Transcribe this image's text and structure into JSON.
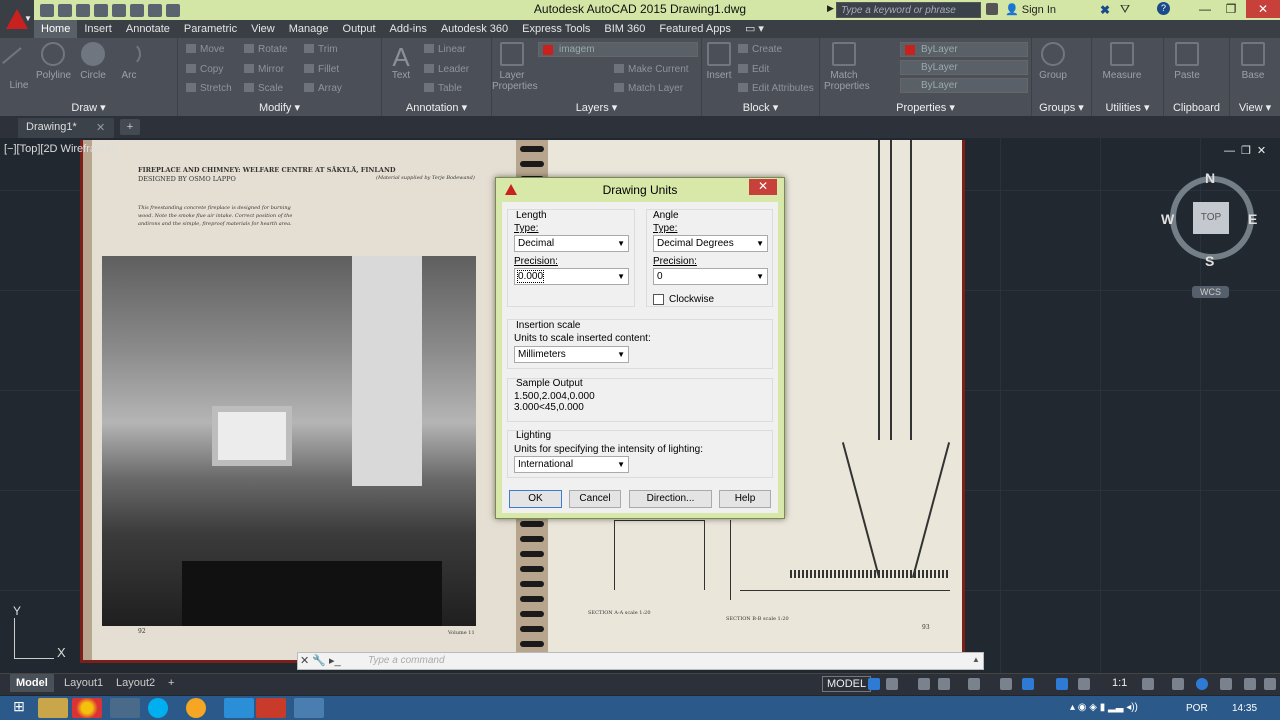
{
  "titlebar": {
    "window_title": "Autodesk AutoCAD 2015    Drawing1.dwg",
    "search_placeholder": "Type a keyword or phrase",
    "signin_label": "Sign In"
  },
  "ribbon_tabs": [
    "Home",
    "Insert",
    "Annotate",
    "Parametric",
    "View",
    "Manage",
    "Output",
    "Add-ins",
    "Autodesk 360",
    "Express Tools",
    "BIM 360",
    "Featured Apps"
  ],
  "ribbon_panels": {
    "draw": {
      "title": "Draw",
      "tools": [
        "Line",
        "Polyline",
        "Circle",
        "Arc"
      ]
    },
    "modify": {
      "title": "Modify",
      "tools": [
        "Move",
        "Rotate",
        "Trim",
        "Copy",
        "Mirror",
        "Fillet",
        "Stretch",
        "Scale",
        "Array"
      ]
    },
    "annotation": {
      "title": "Annotation",
      "tools": [
        "Text",
        "Linear",
        "Leader",
        "Table"
      ]
    },
    "layers": {
      "title": "Layers",
      "current_layer": "imagem",
      "tools": [
        "Layer Properties",
        "Make Current",
        "Match Layer"
      ]
    },
    "block": {
      "title": "Block",
      "tools": [
        "Insert",
        "Create",
        "Edit",
        "Edit Attributes"
      ]
    },
    "properties": {
      "title": "Properties",
      "tools": [
        "Match Properties"
      ],
      "color": "ByLayer",
      "linetype": "ByLayer",
      "lineweight": "ByLayer"
    },
    "groups": {
      "title": "Groups",
      "tools": [
        "Group"
      ]
    },
    "utilities": {
      "title": "Utilities",
      "tools": [
        "Measure"
      ]
    },
    "clipboard": {
      "title": "Clipboard",
      "tools": [
        "Paste"
      ]
    },
    "view": {
      "title": "View",
      "tools": [
        "Base"
      ]
    }
  },
  "file_tab": {
    "label": "Drawing1*"
  },
  "viewport_label": "[−][Top][2D Wireframe]",
  "book": {
    "left_heading": "FIREPLACE AND CHIMNEY: WELFARE CENTRE AT SÄKYLÄ, FINLAND",
    "left_designer": "DESIGNED BY OSMO LAPPO",
    "left_credit": "(Material supplied by Terje Bodewand)",
    "left_caption": "This freestanding concrete fireplace is designed for burning wood. Note the smoke flue air intake. Correct position of the andirons and the simple, fireproof materials for hearth area.",
    "left_page_number": "92",
    "left_volume": "Volume 11",
    "right_page_number": "93",
    "section_a": "SECTION A-A scale 1:20",
    "section_b": "SECTION B-B scale 1:20"
  },
  "dialog": {
    "title": "Drawing Units",
    "length": {
      "group_label": "Length",
      "type_label": "Type:",
      "type_value": "Decimal",
      "precision_label": "Precision:",
      "precision_value": "0.000"
    },
    "angle": {
      "group_label": "Angle",
      "type_label": "Type:",
      "type_value": "Decimal Degrees",
      "precision_label": "Precision:",
      "precision_value": "0",
      "clockwise_label": "Clockwise",
      "clockwise_checked": false
    },
    "insertion": {
      "group_label": "Insertion scale",
      "units_label": "Units to scale inserted content:",
      "units_value": "Millimeters"
    },
    "sample": {
      "group_label": "Sample Output",
      "line1": "1.500,2.004,0.000",
      "line2": "3.000<45,0.000"
    },
    "lighting": {
      "group_label": "Lighting",
      "units_label": "Units for specifying the intensity of lighting:",
      "units_value": "International"
    },
    "buttons": {
      "ok": "OK",
      "cancel": "Cancel",
      "direction": "Direction...",
      "help": "Help"
    }
  },
  "command_line": {
    "placeholder": "Type a command"
  },
  "viewcube": {
    "north": "N",
    "south": "S",
    "east": "E",
    "west": "W",
    "top": "TOP",
    "wcs": "WCS"
  },
  "ucs": {
    "x": "X",
    "y": "Y"
  },
  "layout_tabs": [
    "Model",
    "Layout1",
    "Layout2"
  ],
  "statusbar": {
    "model_label": "MODEL",
    "scale": "1:1"
  },
  "taskbar": {
    "language": "POR",
    "time": "14:35"
  }
}
